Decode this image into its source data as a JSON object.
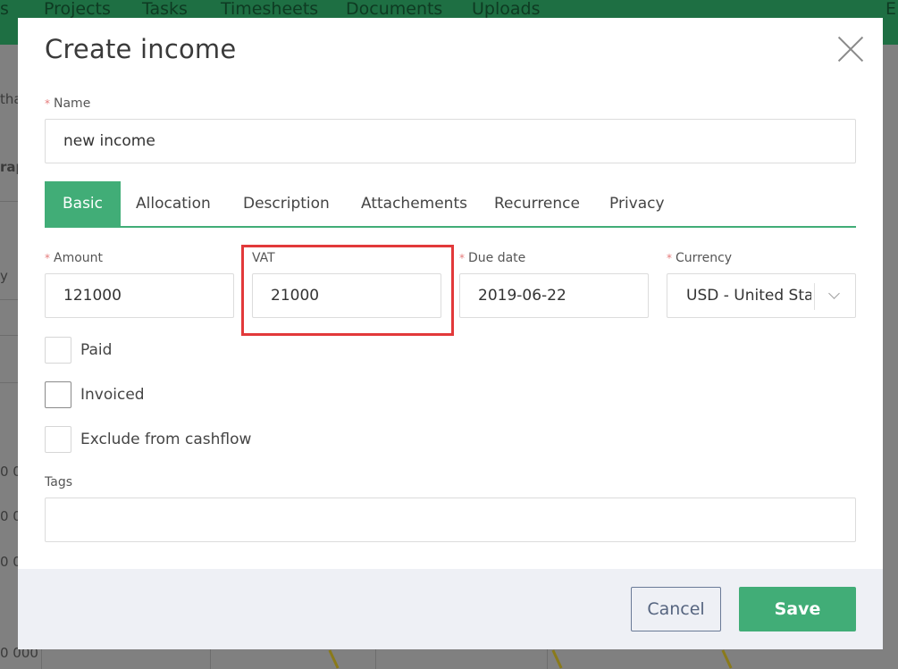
{
  "background": {
    "nav_items": [
      "s",
      "Projects",
      "Tasks",
      "Timesheets",
      "Documents",
      "Uploads",
      "E"
    ],
    "fragments": [
      "tha",
      "rap",
      "y",
      "0 00",
      "0 00",
      "0 00",
      "0 000"
    ]
  },
  "modal": {
    "title": "Create income",
    "close_icon": "close-icon",
    "name": {
      "label": "Name",
      "required_mark": "*",
      "value": "new income"
    },
    "tabs": [
      "Basic",
      "Allocation",
      "Description",
      "Attachements",
      "Recurrence",
      "Privacy"
    ],
    "active_tab": "Basic",
    "amount": {
      "label": "Amount",
      "required_mark": "*",
      "value": "121000"
    },
    "vat": {
      "label": "VAT",
      "value": "21000"
    },
    "due_date": {
      "label": "Due date",
      "required_mark": "*",
      "value": "2019-06-22"
    },
    "currency": {
      "label": "Currency",
      "required_mark": "*",
      "value": "USD - United States",
      "icon": "chevron-down-icon"
    },
    "checkboxes": [
      {
        "label": "Paid",
        "checked": false
      },
      {
        "label": "Invoiced",
        "checked": false
      },
      {
        "label": "Exclude from cashflow",
        "checked": false
      }
    ],
    "tags": {
      "label": "Tags",
      "value": ""
    },
    "footer": {
      "cancel_label": "Cancel",
      "save_label": "Save"
    }
  },
  "colors": {
    "accent": "#41ad77",
    "highlight": "#e2393a",
    "required_mark": "#e57b7b",
    "footer_bg": "#eef0f5",
    "cancel_border": "#6a7a97"
  }
}
